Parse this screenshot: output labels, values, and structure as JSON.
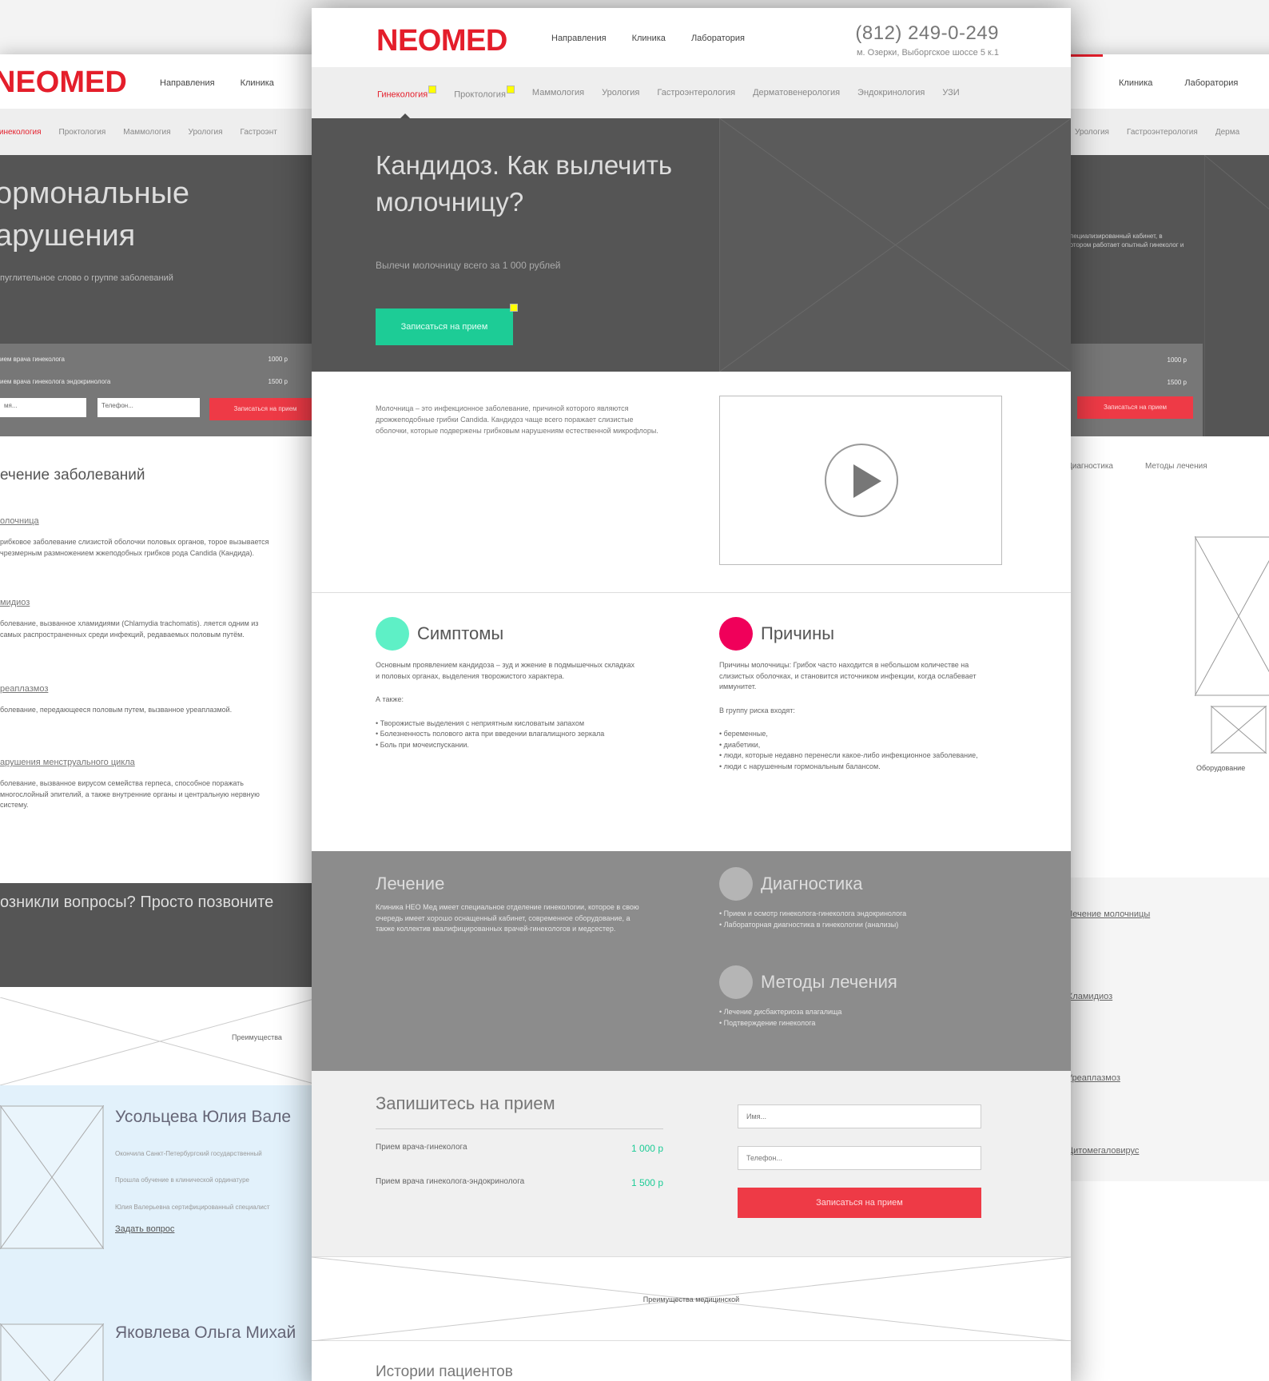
{
  "main": {
    "logo": "NEOMED",
    "nav": [
      "Направления",
      "Клиника",
      "Лаборатория"
    ],
    "phone": "(812) 249-0-249",
    "address": "м. Озерки, Выборгское шоссе 5 к.1",
    "subnav": {
      "active": "Гинекология",
      "items": [
        "Проктология",
        "Маммология",
        "Урология",
        "Гастроэнтерология",
        "Дерматовенерология",
        "Эндокринология",
        "УЗИ"
      ]
    },
    "hero": {
      "title": "Кандидоз. Как вылечить молочницу?",
      "subtitle": "Вылечи молочницу всего за 1 000 рублей",
      "button": "Записаться на прием"
    },
    "description": "Молочница – это инфекционное заболевание, причиной которого являются дрожжеподобные грибки Candida. Кандидоз чаще всего поражает слизистые оболочки, которые подвержены грибковым нарушениям естественной микрофлоры.",
    "symptoms": {
      "title": "Симптомы",
      "color": "#5ef0c6",
      "intro": "Основным проявлением кандидоза – зуд и жжение в подмышечных складках и половых органах, выделения творожистого характера.",
      "also": "А также:",
      "list": [
        "• Творожистые выделения с неприятным кисловатым запахом",
        "• Болезненность полового акта при введении влагалищного зеркала",
        "• Боль при мочеиспускании."
      ]
    },
    "causes": {
      "title": "Причины",
      "color": "#f0005a",
      "intro": "Причины молочницы: Грибок часто находится в небольшом количестве на слизистых оболочках, и становится источником инфекции, когда ослабевает иммунитет.",
      "risk_title": "В группу риска входят:",
      "list": [
        "• беременные,",
        "• диабетики,",
        "• люди, которые недавно перенесли какое-либо инфекционное заболевание,",
        "• люди с нарушенным гормональным балансом."
      ]
    },
    "treatment": {
      "title": "Лечение",
      "text": "Клиника НЕО Мед имеет специальное отделение гинекологии, которое в свою очередь имеет хорошо оснащенный кабинет, современное оборудование, а также коллектив квалифицированных врачей-гинекологов и медсестер."
    },
    "diagnostics": {
      "title": "Диагностика",
      "list": [
        "• Прием и осмотр гинеколога-гинеколога эндокринолога",
        "• Лабораторная диагностика в гинекологии (анализы)"
      ]
    },
    "methods": {
      "title": "Методы лечения",
      "list": [
        "• Лечение дисбактериоза влагалища",
        "• Подтверждение гинеколога"
      ]
    },
    "booking": {
      "title": "Запишитесь на прием",
      "prices": [
        {
          "label": "Прием врача-гинеколога",
          "price": "1 000 р"
        },
        {
          "label": "Прием врача гинеколога-эндокринолога",
          "price": "1 500 р"
        }
      ],
      "name_placeholder": "Имя...",
      "phone_placeholder": "Телефон...",
      "button": "Записаться на прием"
    },
    "advantages": "Преимущества медицинской",
    "stories": "Истории пациентов"
  },
  "left": {
    "logo": "NEOMED",
    "nav": [
      "Направления",
      "Клиника"
    ],
    "subnav": [
      "Гинекология",
      "Проктология",
      "Маммология",
      "Урология",
      "Гастроэнт"
    ],
    "hero_title_1": "ормональные",
    "hero_title_2": "арушения",
    "hero_sub": "пуглительное слово о группе заболеваний",
    "rows": [
      {
        "label": "ием врача гинеколога",
        "price": "1000 р"
      },
      {
        "label": "ием врача гинеколога эндокринолога",
        "price": "1500 р"
      }
    ],
    "name_ph": "мя...",
    "phone_ph": "Телефон...",
    "button": "Записаться на прием",
    "section_title": "ечение заболеваний",
    "items": [
      {
        "title": "олочница",
        "text": "рибковое заболевание слизистой оболочки половых органов, торое вызывается чрезмерным размножением жжеподобных грибков рода Candida (Кандида)."
      },
      {
        "title": "мидиоз",
        "text": "болевание, вызванное хламидиями (Chlamydia trachomatis). ляется одним из самых распространенных среди инфекций, редаваемых половым путём."
      },
      {
        "title": "реаплазмоз",
        "text": "болевание, передающееся половым путем, вызванное уреаплазмой."
      },
      {
        "title": "арушения менструального цикла",
        "text": "болевание, вызванное вирусом семейства герпеса, способное поражать многослойный эпителий, а также внутренние органы и центральную нервную систему."
      }
    ],
    "question": "озникли вопросы? Просто позвоните",
    "advantages": "Преимущества",
    "doctor1": "Усольцева Юлия Вале",
    "doctor2": "Яковлева Ольга Михай",
    "doctor_text_1": "Окончила Санкт-Петербургский государственный",
    "doctor_text_2": "Прошла обучение в клинической ординатуре",
    "doctor_text_3": "Юлия Валерьевна сертифицированный специалист",
    "ask": "Задать вопрос"
  },
  "right": {
    "nav": [
      "Клиника",
      "Лаборатория"
    ],
    "subnav": [
      "Урология",
      "Гастроэнтерология",
      "Дерма"
    ],
    "hero_text": "специализированный кабинет, в котором работает опытный гинеколог и",
    "prices": [
      "1000 р",
      "1500 р"
    ],
    "button": "Записаться на прием",
    "tabs": [
      "Диагностика",
      "Методы лечения"
    ],
    "equipment": "Оборудование",
    "links": [
      "Лечение молочницы",
      "Хламидиоз",
      "Уреаплазмоз",
      "Цитомегаловирус"
    ]
  }
}
